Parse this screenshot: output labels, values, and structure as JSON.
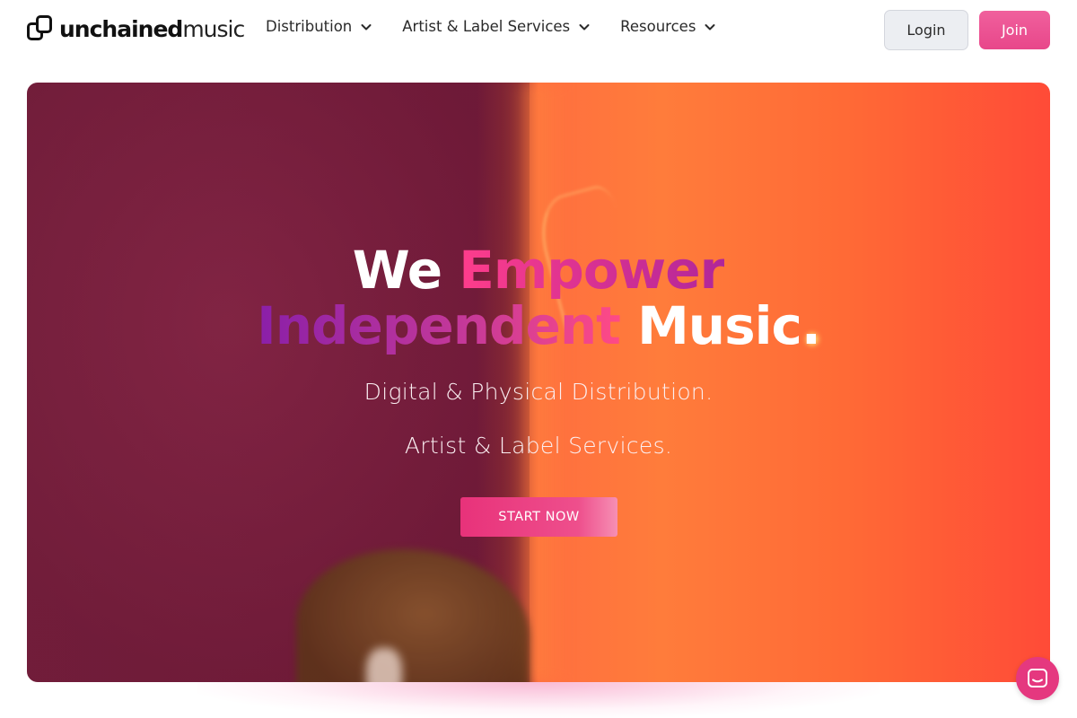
{
  "brand": {
    "name_bold": "unchained",
    "name_light": "music",
    "accent_color": "#e8478a"
  },
  "nav": {
    "items": [
      {
        "label": "Distribution",
        "icon": "chevron-down-icon"
      },
      {
        "label": "Artist & Label Services",
        "icon": "chevron-down-icon"
      },
      {
        "label": "Resources",
        "icon": "chevron-down-icon"
      }
    ],
    "login_label": "Login",
    "join_label": "Join"
  },
  "hero": {
    "headline": {
      "we": "We",
      "empower": "Empower",
      "independent": "Independent",
      "music": "Music."
    },
    "sub_line_1": "Digital & Physical Distribution.",
    "sub_line_2": "Artist & Label Services.",
    "cta_label": "START NOW"
  },
  "chat": {
    "icon": "chat-icon"
  }
}
